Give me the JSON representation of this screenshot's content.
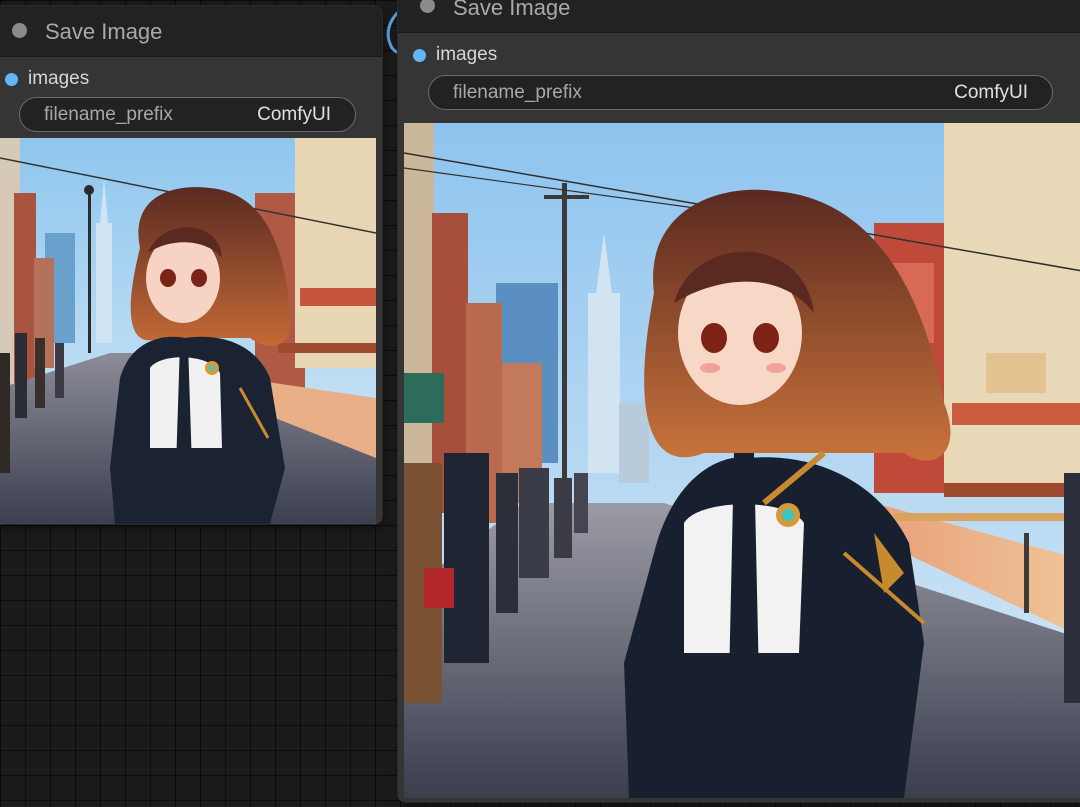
{
  "nodes": [
    {
      "title": "Save Image",
      "input_label": "images",
      "widget": {
        "name": "filename_prefix",
        "value": "ComfyUI"
      },
      "preview": {
        "description_icon": "generated-anime-girl-street-image"
      }
    },
    {
      "title": "Save Image",
      "input_label": "images",
      "widget": {
        "name": "filename_prefix",
        "value": "ComfyUI"
      },
      "preview": {
        "description_icon": "generated-anime-girl-street-image"
      }
    }
  ],
  "colors": {
    "canvas_bg": "#1b1b1b",
    "node_bg": "#353535",
    "node_header": "#222222",
    "slot_image": "#64b5f6",
    "link_image": "#64b5f6"
  }
}
